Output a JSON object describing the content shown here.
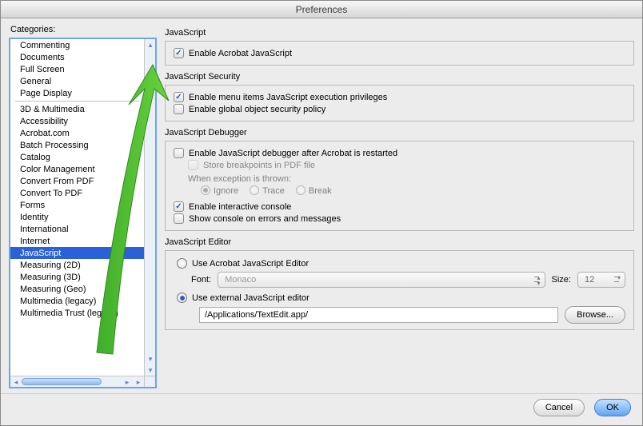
{
  "window": {
    "title": "Preferences"
  },
  "categories": {
    "label": "Categories:",
    "top": [
      "Commenting",
      "Documents",
      "Full Screen",
      "General",
      "Page Display"
    ],
    "rest": [
      "3D & Multimedia",
      "Accessibility",
      "Acrobat.com",
      "Batch Processing",
      "Catalog",
      "Color Management",
      "Convert From PDF",
      "Convert To PDF",
      "Forms",
      "Identity",
      "International",
      "Internet",
      "JavaScript",
      "Measuring (2D)",
      "Measuring (3D)",
      "Measuring (Geo)",
      "Multimedia (legacy)",
      "Multimedia Trust (legacy)"
    ],
    "selected": "JavaScript"
  },
  "panel": {
    "js": {
      "title": "JavaScript",
      "enable": "Enable Acrobat JavaScript"
    },
    "security": {
      "title": "JavaScript Security",
      "menu": "Enable menu items JavaScript execution privileges",
      "global": "Enable global object security policy"
    },
    "debugger": {
      "title": "JavaScript Debugger",
      "enable": "Enable JavaScript debugger after Acrobat is restarted",
      "store": "Store breakpoints in PDF file",
      "when": "When exception is thrown:",
      "ignore": "Ignore",
      "trace": "Trace",
      "break": "Break",
      "interactive": "Enable interactive console",
      "showconsole": "Show console on errors and messages"
    },
    "editor": {
      "title": "JavaScript Editor",
      "use_acrobat": "Use Acrobat JavaScript Editor",
      "font_label": "Font:",
      "font_value": "Monaco",
      "size_label": "Size:",
      "size_value": "12",
      "use_external": "Use external JavaScript editor",
      "path": "/Applications/TextEdit.app/",
      "browse": "Browse..."
    }
  },
  "footer": {
    "cancel": "Cancel",
    "ok": "OK"
  }
}
